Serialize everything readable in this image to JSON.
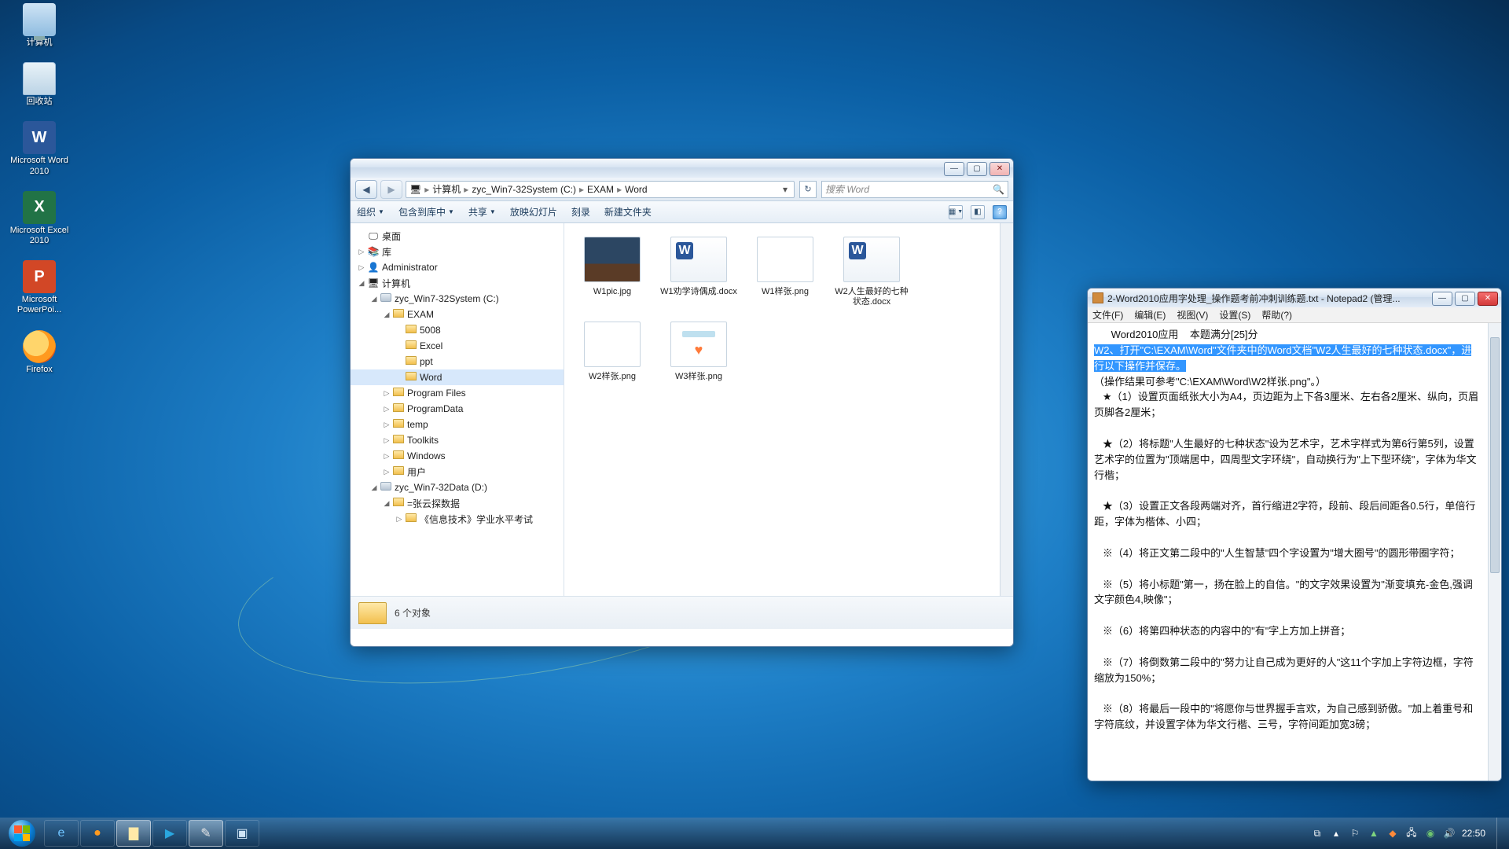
{
  "desktop_icons": [
    {
      "name": "computer",
      "label": "计算机"
    },
    {
      "name": "recycle",
      "label": "回收站"
    },
    {
      "name": "word",
      "label": "Microsoft Word 2010"
    },
    {
      "name": "excel",
      "label": "Microsoft Excel 2010"
    },
    {
      "name": "ppt",
      "label": "Microsoft PowerPoi..."
    },
    {
      "name": "firefox",
      "label": "Firefox"
    }
  ],
  "explorer": {
    "breadcrumb": [
      "计算机",
      "zyc_Win7-32System (C:)",
      "EXAM",
      "Word"
    ],
    "search_placeholder": "搜索 Word",
    "toolbar": {
      "organize": "组织",
      "include": "包含到库中",
      "share": "共享",
      "slideshow": "放映幻灯片",
      "burn": "刻录",
      "newfolder": "新建文件夹"
    },
    "tree": [
      {
        "d": 0,
        "ic": "desk",
        "t": "桌面",
        "ex": ""
      },
      {
        "d": 0,
        "ic": "lib",
        "t": "库",
        "ex": "▷"
      },
      {
        "d": 0,
        "ic": "user",
        "t": "Administrator",
        "ex": "▷"
      },
      {
        "d": 0,
        "ic": "comp",
        "t": "计算机",
        "ex": "◢"
      },
      {
        "d": 1,
        "ic": "drv",
        "t": "zyc_Win7-32System (C:)",
        "ex": "◢"
      },
      {
        "d": 2,
        "ic": "f",
        "t": "EXAM",
        "ex": "◢"
      },
      {
        "d": 3,
        "ic": "f",
        "t": "5008",
        "ex": ""
      },
      {
        "d": 3,
        "ic": "f",
        "t": "Excel",
        "ex": ""
      },
      {
        "d": 3,
        "ic": "f",
        "t": "ppt",
        "ex": ""
      },
      {
        "d": 3,
        "ic": "f",
        "t": "Word",
        "ex": "",
        "sel": true
      },
      {
        "d": 2,
        "ic": "f",
        "t": "Program Files",
        "ex": "▷"
      },
      {
        "d": 2,
        "ic": "f",
        "t": "ProgramData",
        "ex": "▷"
      },
      {
        "d": 2,
        "ic": "f",
        "t": "temp",
        "ex": "▷"
      },
      {
        "d": 2,
        "ic": "f",
        "t": "Toolkits",
        "ex": "▷"
      },
      {
        "d": 2,
        "ic": "f",
        "t": "Windows",
        "ex": "▷"
      },
      {
        "d": 2,
        "ic": "f",
        "t": "用户",
        "ex": "▷"
      },
      {
        "d": 1,
        "ic": "drv",
        "t": "zyc_Win7-32Data (D:)",
        "ex": "◢"
      },
      {
        "d": 2,
        "ic": "f",
        "t": "=张云探数据",
        "ex": "◢"
      },
      {
        "d": 3,
        "ic": "f",
        "t": "《信息技术》学业水平考试",
        "ex": "▷"
      }
    ],
    "files": [
      {
        "n": "W1pic.jpg",
        "k": "img1"
      },
      {
        "n": "W1劝学诗偶成.docx",
        "k": "doc"
      },
      {
        "n": "W1样张.png",
        "k": "img2"
      },
      {
        "n": "W2人生最好的七种状态.docx",
        "k": "doc"
      },
      {
        "n": "W2样张.png",
        "k": "img3"
      },
      {
        "n": "W3样张.png",
        "k": "img4"
      }
    ],
    "status": "6 个对象"
  },
  "notepad": {
    "title": "2-Word2010应用字处理_操作题考前冲刺训练题.txt - Notepad2 (管理...",
    "menu": [
      "文件(F)",
      "编辑(E)",
      "视图(V)",
      "设置(S)",
      "帮助(?)"
    ],
    "head": "      Word2010应用    本题满分[25]分",
    "hl": "W2、打开\"C:\\EXAM\\Word\"文件夹中的Word文档\"W2人生最好的七种状态.docx\"，进行以下操作并保存。",
    "ref": "（操作结果可参考\"C:\\EXAM\\Word\\W2样张.png\"。）",
    "body": "\n   ★（1）设置页面纸张大小为A4，页边距为上下各3厘米、左右各2厘米、纵向，页眉页脚各2厘米；\n\n   ★（2）将标题\"人生最好的七种状态\"设为艺术字，艺术字样式为第6行第5列，设置艺术字的位置为\"顶端居中，四周型文字环绕\"，自动换行为\"上下型环绕\"，字体为华文行楷；\n\n   ★（3）设置正文各段两端对齐，首行缩进2字符，段前、段后间距各0.5行，单倍行距，字体为楷体、小四；\n\n   ※（4）将正文第二段中的\"人生智慧\"四个字设置为\"增大圈号\"的圆形带圈字符；\n\n   ※（5）将小标题\"第一，扬在脸上的自信。\"的文字效果设置为\"渐变填充-金色,强调文字颜色4,映像\"；\n\n   ※（6）将第四种状态的内容中的\"有\"字上方加上拼音；\n\n   ※（7）将倒数第二段中的\"努力让自己成为更好的人\"这11个字加上字符边框，字符缩放为150%；\n\n   ※（8）将最后一段中的\"将愿你与世界握手言欢，为自己感到骄傲。\"加上着重号和字符底纹，并设置字体为华文行楷、三号，字符间距加宽3磅；"
  },
  "taskbar": {
    "time": "22:50"
  }
}
